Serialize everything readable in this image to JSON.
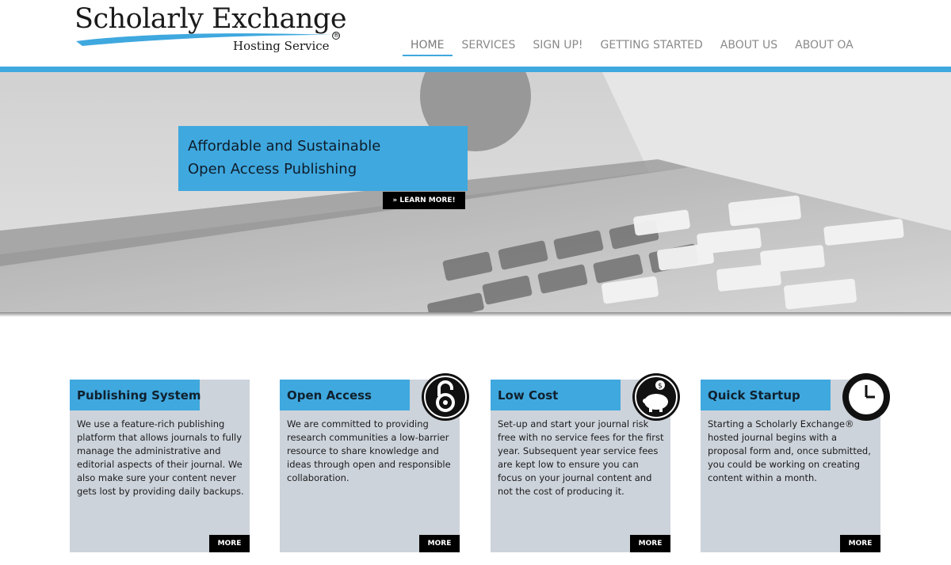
{
  "logo": {
    "title": "Scholarly Exchange",
    "subtitle": "Hosting Service",
    "registered_mark": "®"
  },
  "nav": {
    "items": [
      {
        "label": "HOME",
        "active": true
      },
      {
        "label": "SERVICES",
        "active": false
      },
      {
        "label": "SIGN UP!",
        "active": false
      },
      {
        "label": "GETTING STARTED",
        "active": false
      },
      {
        "label": "ABOUT US",
        "active": false
      },
      {
        "label": "ABOUT OA",
        "active": false
      }
    ]
  },
  "hero": {
    "title": "Affordable and Sustainable",
    "subtitle": "Open Access Publishing",
    "button_label": "» LEARN MORE!"
  },
  "cards": [
    {
      "title": "Publishing System",
      "text": "We use a feature-rich publishing platform that allows journals to fully manage the administrative and editorial aspects of their journal. We also make sure your content never gets lost by providing daily backups.",
      "more_label": "MORE",
      "icon": "none"
    },
    {
      "title": "Open Access",
      "text": "We are committed to providing research communities a low-barrier resource to share knowledge and ideas through open and responsible collaboration.",
      "more_label": "MORE",
      "icon": "open-access-lock-icon"
    },
    {
      "title": "Low Cost",
      "text": "Set-up and start your journal risk free with no service fees for the first year. Subsequent year service fees are kept low to ensure you can focus on your journal content and not the cost of producing it.",
      "more_label": "MORE",
      "icon": "piggy-bank-icon"
    },
    {
      "title": "Quick Startup",
      "text": "Starting a Scholarly Exchange® hosted journal begins with a proposal form and, once submitted, you could be working on creating content within a month.",
      "more_label": "MORE",
      "icon": "clock-icon"
    }
  ],
  "colors": {
    "accent": "#3fa8df",
    "card_bg": "#cdd3db",
    "button_bg": "#000000",
    "nav_text": "#8a8a8a"
  }
}
